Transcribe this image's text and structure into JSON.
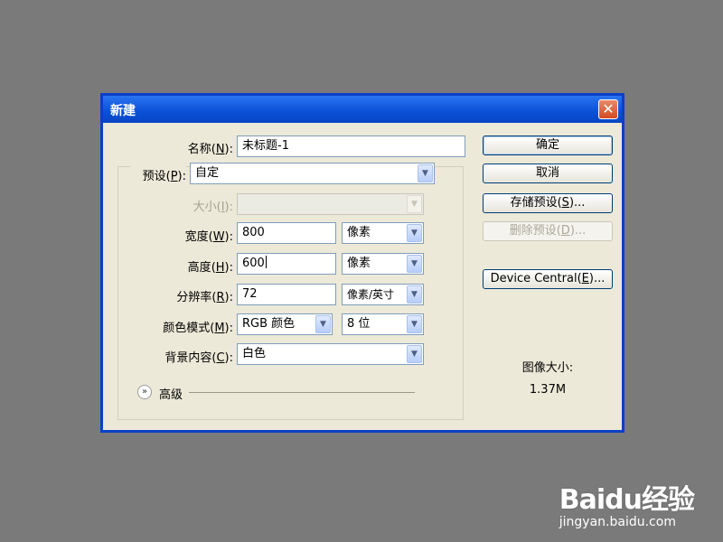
{
  "dialog": {
    "title": "新建",
    "close_glyph": "✕"
  },
  "fields": {
    "name": {
      "label": "名称",
      "mnemonic": "N",
      "value": "未标题-1"
    },
    "preset": {
      "label": "预设",
      "mnemonic": "P",
      "value": "自定"
    },
    "size": {
      "label": "大小",
      "mnemonic": "I",
      "value": ""
    },
    "width": {
      "label": "宽度",
      "mnemonic": "W",
      "value": "800",
      "unit": "像素"
    },
    "height": {
      "label": "高度",
      "mnemonic": "H",
      "value": "600",
      "unit": "像素"
    },
    "resolution": {
      "label": "分辨率",
      "mnemonic": "R",
      "value": "72",
      "unit": "像素/英寸"
    },
    "color_mode": {
      "label": "颜色模式",
      "mnemonic": "M",
      "value": "RGB 颜色",
      "depth": "8 位"
    },
    "background": {
      "label": "背景内容",
      "mnemonic": "C",
      "value": "白色"
    }
  },
  "advanced": {
    "label": "高级",
    "icon": "chevron-double-down-icon"
  },
  "buttons": {
    "ok": "确定",
    "cancel": "取消",
    "save_preset": {
      "label": "存储预设",
      "mnemonic": "S",
      "suffix": "..."
    },
    "delete_preset": {
      "label": "删除预设",
      "mnemonic": "D",
      "suffix": "..."
    },
    "device_central": {
      "label": "Device Central",
      "mnemonic": "E",
      "suffix": "..."
    }
  },
  "image_size": {
    "label": "图像大小:",
    "value": "1.37M"
  },
  "watermark": {
    "logo": "Baidu经验",
    "url": "jingyan.baidu.com"
  },
  "colors": {
    "desktop": "#7a7a7a",
    "dialog_bg": "#ece9d8",
    "titlebar": "#0a50d8",
    "close": "#d44a22"
  }
}
